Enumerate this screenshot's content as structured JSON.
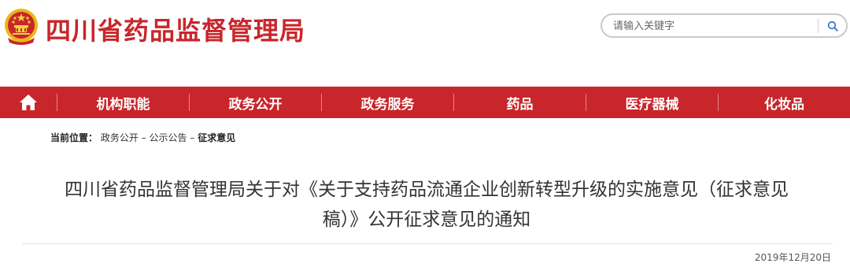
{
  "header": {
    "site_title": "四川省药品监督管理局"
  },
  "search": {
    "placeholder": "请输入关键字"
  },
  "nav": {
    "items": [
      {
        "label": "机构职能"
      },
      {
        "label": "政务公开"
      },
      {
        "label": "政务服务"
      },
      {
        "label": "药品"
      },
      {
        "label": "医疗器械"
      },
      {
        "label": "化妆品"
      }
    ]
  },
  "breadcrumb": {
    "label": "当前位置：",
    "item1": "政务公开",
    "sep": "–",
    "item2": "公示公告",
    "current": "征求意见"
  },
  "article": {
    "title_line1": "四川省药品监督管理局关于对《关于支持药品流通企业创新转型升级的实施意见（征求意见",
    "title_line2": "稿）》公开征求意见的通知",
    "date": "2019年12月20日"
  },
  "colors": {
    "brand_red": "#c8262b",
    "emblem_gold": "#e8b818"
  }
}
